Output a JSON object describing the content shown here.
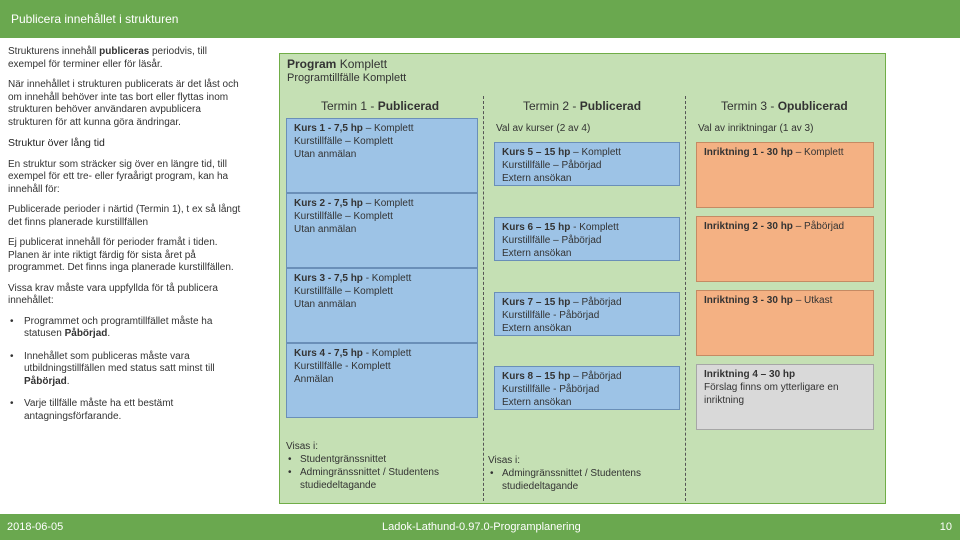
{
  "header": {
    "title": "Publicera innehållet i strukturen"
  },
  "sidebar": {
    "p1_pre": "Strukturens innehåll ",
    "p1_bold": "publiceras",
    "p1_post": " periodvis, till exempel för terminer eller för läsår.",
    "p2": "När innehållet i strukturen publicerats är det låst och om innehåll behöver inte tas bort eller flyttas inom strukturen behöver användaren avpublicera strukturen för att kunna göra ändringar.",
    "subtitle": "Struktur över lång tid",
    "p3": "En struktur som sträcker sig över en längre tid, till exempel för ett tre- eller fyraårigt program, kan ha innehåll för:",
    "p4": "Publicerade perioder i närtid (Termin 1), t ex så långt det finns planerade kurstillfällen",
    "p5": "Ej publicerat innehåll för perioder framåt i tiden. Planen är inte riktigt färdig för sista året på programmet. Det finns inga planerade kurstillfällen.",
    "p6": "Vissa krav måste vara uppfyllda för tå publicera innehållet:",
    "bullet1_pre": "Programmet och programtillfället måste ha statusen ",
    "bullet1_bold": "Påbörjad",
    "bullet1_post": ".",
    "bullet2_pre": "Innehållet som publiceras måste vara utbildningstillfällen med status satt minst till ",
    "bullet2_bold": "Påbörjad",
    "bullet2_post": ".",
    "bullet3": "Varje tillfälle måste ha ett bestämt antagningsförfarande."
  },
  "panel": {
    "program_bold": "Program",
    "program_rest": " Komplett",
    "programtillfalle": "Programtillfälle Komplett",
    "col1": {
      "head_pre": "Termin 1 - ",
      "head_bold": "Publicerad"
    },
    "col2": {
      "head_pre": "Termin 2 - ",
      "head_bold": "Publicerad"
    },
    "col3": {
      "head_pre": "Termin 3 - ",
      "head_bold": "Opublicerad"
    },
    "col2_label": "Val av kurser (2 av 4)",
    "col3_label": "Val av inriktningar (1 av 3)",
    "t1_courses": [
      {
        "name": "Kurs 1",
        "hp": " - 7,5 hp",
        "status": " – Komplett",
        "line2": "Kurstillfälle – Komplett",
        "line3": "Utan anmälan"
      },
      {
        "name": "Kurs 2",
        "hp": " - 7,5 hp",
        "status": " – Komplett",
        "line2": "Kurstillfälle – Komplett",
        "line3": "Utan anmälan"
      },
      {
        "name": "Kurs 3",
        "hp": " - 7,5 hp",
        "status": " - Komplett",
        "line2": "Kurstillfälle – Komplett",
        "line3": "Utan anmälan"
      },
      {
        "name": "Kurs 4",
        "hp": " - 7,5 hp",
        "status": " - Komplett",
        "line2": "Kurstillfälle - Komplett",
        "line3": "Anmälan"
      }
    ],
    "t2_courses": [
      {
        "name": "Kurs 5",
        "hp": " – 15 hp",
        "status": " – Komplett",
        "line2": "Kurstillfälle – Påbörjad",
        "line3": "Extern ansökan"
      },
      {
        "name": "Kurs 6",
        "hp": " – 15 hp",
        "status": " - Komplett",
        "line2": "Kurstillfälle – Påbörjad",
        "line3": "Extern ansökan"
      },
      {
        "name": "Kurs 7",
        "hp": " – 15 hp",
        "status": " – Påbörjad",
        "line2": "Kurstillfälle - Påbörjad",
        "line3": "Extern ansökan"
      },
      {
        "name": "Kurs 8",
        "hp": " – 15 hp",
        "status": " – Påbörjad",
        "line2": "Kurstillfälle - Påbörjad",
        "line3": "Extern ansökan"
      }
    ],
    "t3_items": [
      {
        "name": "Inriktning 1",
        "hp": " - 30 hp",
        "status": " – Komplett"
      },
      {
        "name": "Inriktning 2",
        "hp": " - 30 hp",
        "status": " – Påbörjad"
      },
      {
        "name": "Inriktning 3",
        "hp": " - 30 hp",
        "status": " – Utkast"
      },
      {
        "name": "Inriktning 4 – 30 hp",
        "line2": "Förslag finns om ytterligare en inriktning"
      }
    ],
    "visas1": {
      "label": "Visas i:",
      "items": [
        "Studentgränssnittet",
        "Admingränssnittet / Studentens studiedeltagande"
      ]
    },
    "visas2": {
      "label": "Visas i:",
      "items": [
        "Admingränssnittet / Studentens studiedeltagande"
      ]
    }
  },
  "footer": {
    "date": "2018-06-05",
    "title": "Ladok-Lathund-0.97.0-Programplanering",
    "page": "10"
  },
  "colors": {
    "accent_green": "#6aa84f",
    "panel_green": "#c5e0b4",
    "blue_box": "#9dc3e6",
    "orange_box": "#f4b183",
    "gray_box": "#d9d9d9"
  }
}
